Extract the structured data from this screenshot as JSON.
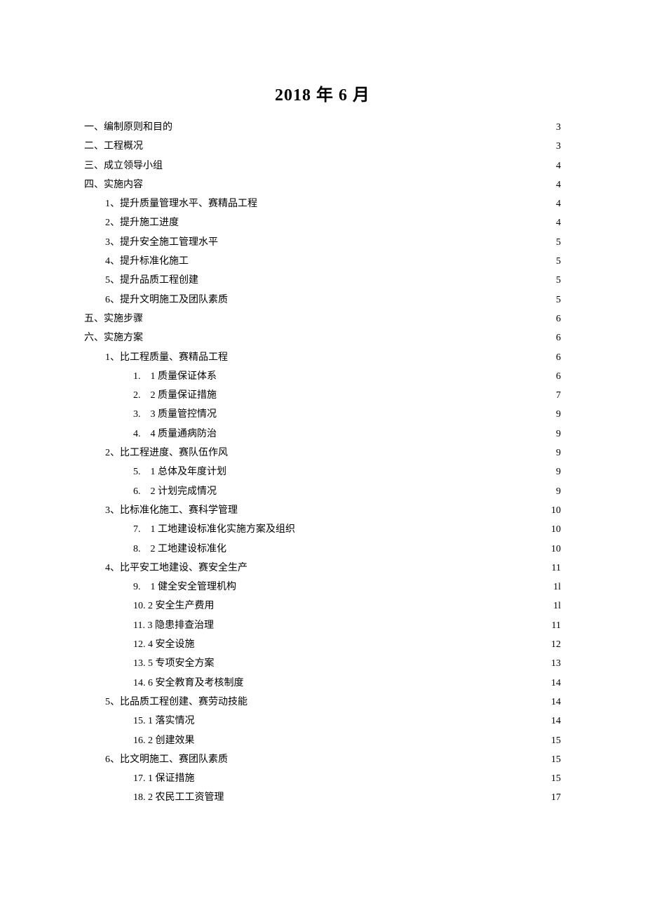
{
  "title": "2018 年 6 月",
  "toc": [
    {
      "level": 0,
      "label": "一、编制原则和目的",
      "page": "3"
    },
    {
      "level": 0,
      "label": "二、工程概况",
      "page": "3"
    },
    {
      "level": 0,
      "label": "三、成立领导小组",
      "page": "4"
    },
    {
      "level": 0,
      "label": "四、实施内容",
      "page": "4"
    },
    {
      "level": 1,
      "label": "1、提升质量管理水平、赛精品工程",
      "page": "4"
    },
    {
      "level": 1,
      "label": "2、提升施工进度",
      "page": "4"
    },
    {
      "level": 1,
      "label": "3、提升安全施工管理水平",
      "page": "5"
    },
    {
      "level": 1,
      "label": "4、提升标准化施工",
      "page": "5"
    },
    {
      "level": 1,
      "label": "5、提升品质工程创建",
      "page": "5"
    },
    {
      "level": 1,
      "label": "6、提升文明施工及团队素质",
      "page": "5"
    },
    {
      "level": 0,
      "label": "五、实施步骤",
      "page": "6"
    },
    {
      "level": 0,
      "label": "六、实施方案",
      "page": "6"
    },
    {
      "level": 1,
      "label": "1、比工程质量、赛精品工程",
      "page": "6"
    },
    {
      "level": 2,
      "label": "1.　1 质量保证体系",
      "page": "6"
    },
    {
      "level": 2,
      "label": "2.　2 质量保证措施",
      "page": "7"
    },
    {
      "level": 2,
      "label": "3.　3 质量管控情况",
      "page": "9"
    },
    {
      "level": 2,
      "label": "4.　4 质量通病防治",
      "page": "9"
    },
    {
      "level": 1,
      "label": "2、比工程进度、赛队伍作风",
      "page": "9"
    },
    {
      "level": 2,
      "label": "5.　1 总体及年度计划",
      "page": "9"
    },
    {
      "level": 2,
      "label": "6.　2 计划完成情况",
      "page": "9"
    },
    {
      "level": 1,
      "label": "3、比标准化施工、赛科学管理",
      "page": "10"
    },
    {
      "level": 2,
      "label": "7.　1 工地建设标准化实施方案及组织",
      "page": "10"
    },
    {
      "level": 2,
      "label": "8.　2 工地建设标准化",
      "page": "10"
    },
    {
      "level": 1,
      "label": "4、比平安工地建设、赛安全生产",
      "page": "11"
    },
    {
      "level": 2,
      "label": "9.　1 健全安全管理机构",
      "page": "1l"
    },
    {
      "level": 2,
      "label": "10. 2 安全生产费用",
      "page": "1l"
    },
    {
      "level": 2,
      "label": "11. 3 隐患排查治理",
      "page": "11"
    },
    {
      "level": 2,
      "label": "12. 4 安全设施",
      "page": "12"
    },
    {
      "level": 2,
      "label": "13. 5 专项安全方案",
      "page": "13"
    },
    {
      "level": 2,
      "label": "14. 6 安全教育及考核制度",
      "page": "14"
    },
    {
      "level": 1,
      "label": "5、比品质工程创建、赛劳动技能",
      "page": "14"
    },
    {
      "level": 2,
      "label": "15. 1 落实情况",
      "page": "14"
    },
    {
      "level": 2,
      "label": "16. 2 创建效果",
      "page": "15"
    },
    {
      "level": 1,
      "label": "6、比文明施工、赛团队素质",
      "page": "15"
    },
    {
      "level": 2,
      "label": "17. 1 保证措施",
      "page": "15"
    },
    {
      "level": 2,
      "label": "18. 2 农民工工资管理",
      "page": "17"
    }
  ]
}
